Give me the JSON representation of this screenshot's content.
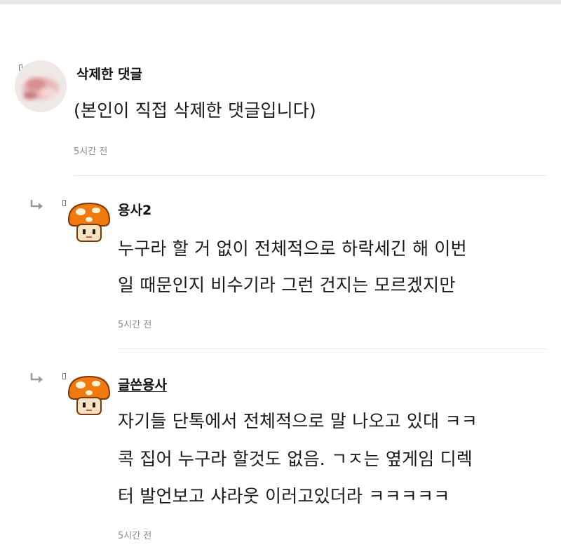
{
  "comments": [
    {
      "author": "삭제한 댓글",
      "lines": [
        "(본인이 직접 삭제한 댓글입니다)"
      ],
      "time": "5시간 전",
      "avatar": "blurred-photo-avatar"
    },
    {
      "author": "용사2",
      "lines": [
        "누구라 할 거 없이 전체적으로 하락세긴 해 이번",
        "일 때문인지 비수기라 그런 건지는 모르겠지만"
      ],
      "time": "5시간 전",
      "avatar": "orange-mushroom-avatar"
    },
    {
      "author": "글쓴용사",
      "lines": [
        "자기들 단톡에서 전체적으로 말 나오고 있대 ㅋㅋ",
        "콕 집어 누구라 할것도 없음. ㄱㅈ는 옆게임 디렉",
        "터 발언보고 샤라웃 이러고있더라 ㅋㅋㅋㅋㅋ"
      ],
      "time": "5시간 전",
      "avatar": "orange-mushroom-avatar"
    }
  ],
  "colors": {
    "mushroom_cap": "#f07a10",
    "mushroom_spot": "#fff3d6",
    "mushroom_face": "#f6e3c4",
    "divider": "#e4e4e4",
    "time_text": "#8a8a8a"
  }
}
